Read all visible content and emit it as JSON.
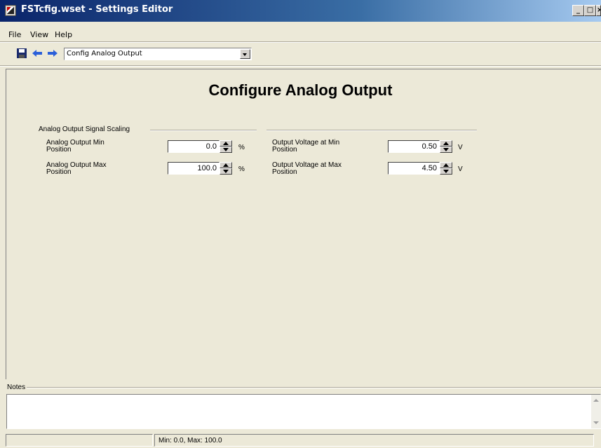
{
  "window": {
    "title": "FSTcfig.wset - Settings Editor"
  },
  "menu": [
    {
      "label": "File"
    },
    {
      "label": "View"
    },
    {
      "label": "Help"
    }
  ],
  "toolbar": {
    "icons": [
      "save-icon",
      "back-arrow-icon",
      "forward-arrow-icon"
    ],
    "page_select": "Config Analog Output"
  },
  "page": {
    "title": "Configure Analog Output",
    "group_label": "Analog Output Signal Scaling",
    "fields": [
      {
        "label_line1": "Analog Output Min",
        "label_line2": "Position",
        "value": "0.0",
        "unit": "%"
      },
      {
        "label_line1": "Analog Output Max",
        "label_line2": "Position",
        "value": "100.0",
        "unit": "%"
      },
      {
        "label_line1": "Output Voltage at Min",
        "label_line2": "Position",
        "value": "0.50",
        "unit": "V"
      },
      {
        "label_line1": "Output Voltage at Max",
        "label_line2": "Position",
        "value": "4.50",
        "unit": "V"
      }
    ]
  },
  "notes": {
    "label": "Notes",
    "value": ""
  },
  "status": {
    "text": "Min: 0.0, Max: 100.0"
  },
  "colors": {
    "title_gradient_start": "#0a246a",
    "title_gradient_end": "#a6caf0",
    "face": "#ece9d8"
  }
}
